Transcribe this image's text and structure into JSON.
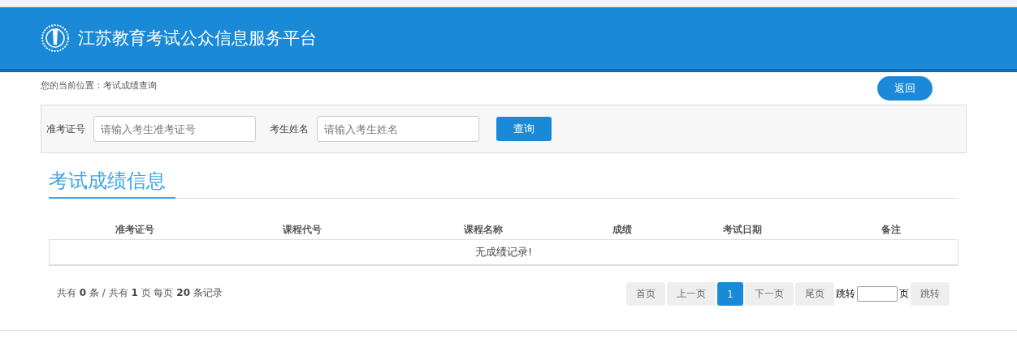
{
  "header": {
    "title": "江苏教育考试公众信息服务平台"
  },
  "breadcrumb": "您的当前位置：考试成绩查询",
  "back_button": "返回",
  "search": {
    "fields": [
      {
        "label": "准考证号",
        "placeholder": "请输入考生准考证号"
      },
      {
        "label": "考生姓名",
        "placeholder": "请输入考生姓名"
      }
    ],
    "button": "查询"
  },
  "section_title": "考试成绩信息",
  "table": {
    "columns": [
      "准考证号",
      "课程代号",
      "课程名称",
      "成绩",
      "考试日期",
      "备注"
    ],
    "empty_message": "无成绩记录!"
  },
  "summary": "共有 **0** 条 / 共有 **1** 页 每页 **20** 条记录",
  "pagination": {
    "items": [
      {
        "kind": "button",
        "label": "首页",
        "selected": false
      },
      {
        "kind": "button",
        "label": "上一页",
        "selected": false
      },
      {
        "kind": "button",
        "label": "1",
        "selected": true
      },
      {
        "kind": "button",
        "label": "下一页",
        "selected": false
      },
      {
        "kind": "button",
        "label": "尾页",
        "selected": false
      }
    ],
    "jump_label": "跳转",
    "page_unit": "页",
    "jump_button": "跳转"
  }
}
